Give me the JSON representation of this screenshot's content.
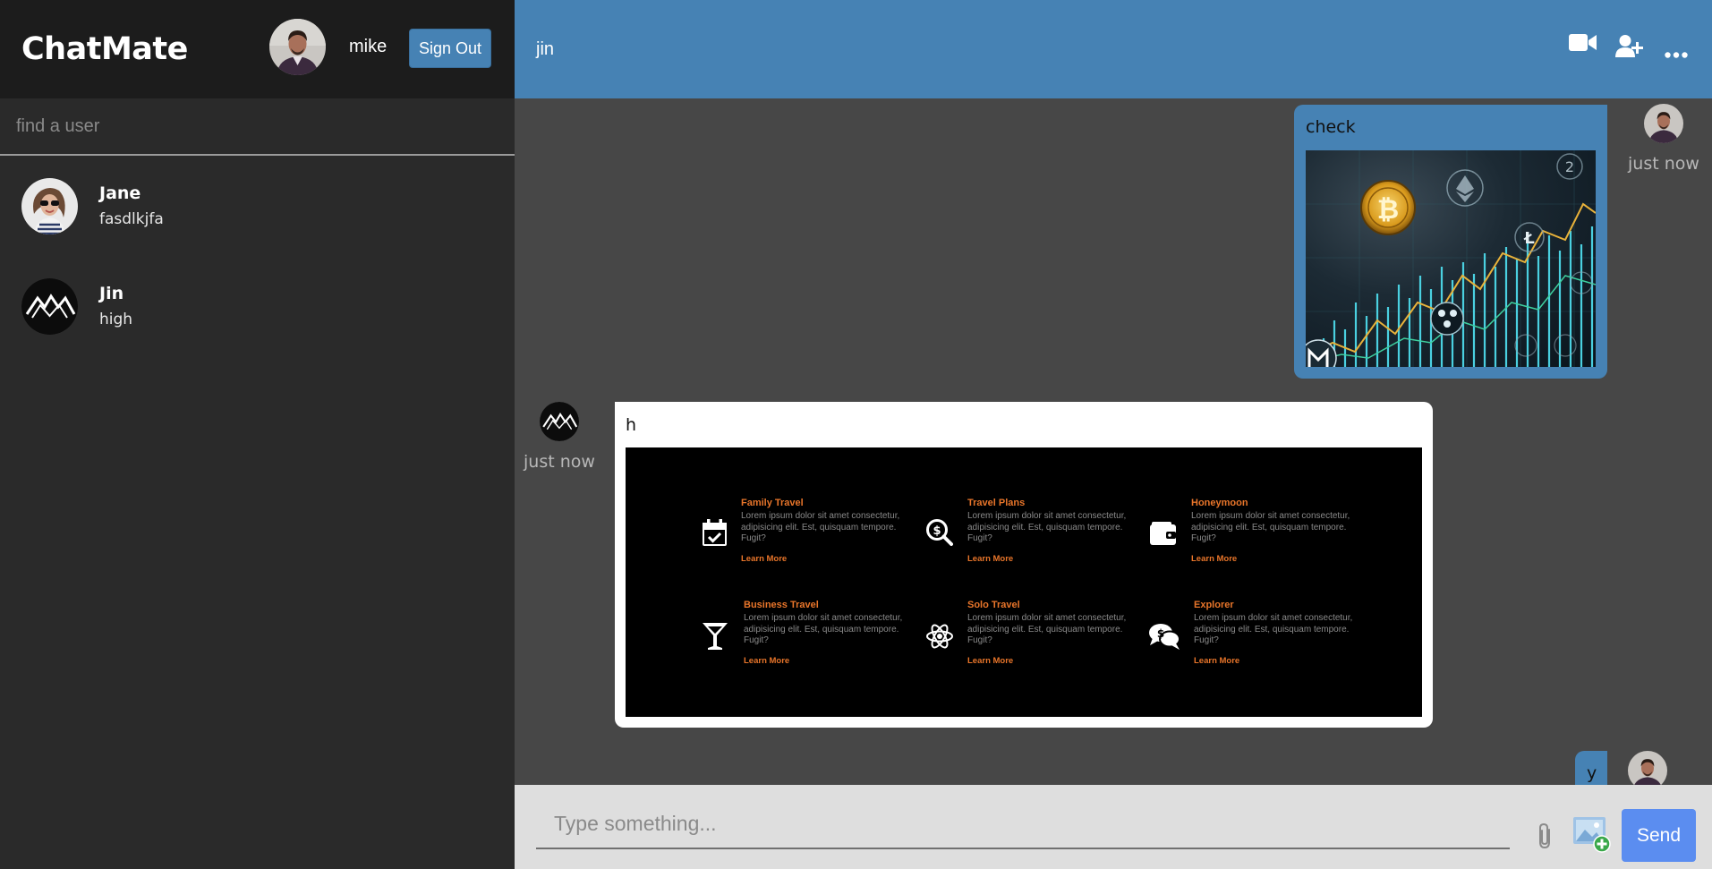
{
  "app": {
    "brand": "ChatMate",
    "current_user": {
      "name": "mike"
    },
    "signout_label": "Sign Out"
  },
  "search": {
    "placeholder": "find a user",
    "value": ""
  },
  "chats": [
    {
      "name": "Jane",
      "last_message": "fasdlkjfa"
    },
    {
      "name": "Jin",
      "last_message": "high"
    }
  ],
  "active_chat": {
    "title": "jin",
    "header_icons": [
      "video-camera-icon",
      "add-user-icon",
      "more-options-icon"
    ]
  },
  "messages": [
    {
      "owner": true,
      "text": "check",
      "time": "just now",
      "image": "crypto-chart-image"
    },
    {
      "owner": false,
      "text": "h",
      "time": "just now",
      "image": "travel-services-image",
      "cards": [
        {
          "title": "Family Travel",
          "body": "Lorem ipsum dolor sit amet consectetur, adipisicing elit. Est, quisquam tempore. Fugit?",
          "link": "Learn More",
          "icon": "calendar-check-icon"
        },
        {
          "title": "Travel Plans",
          "body": "Lorem ipsum dolor sit amet consectetur, adipisicing elit. Est, quisquam tempore. Fugit?",
          "link": "Learn More",
          "icon": "search-dollar-icon"
        },
        {
          "title": "Honeymoon",
          "body": "Lorem ipsum dolor sit amet consectetur, adipisicing elit. Est, quisquam tempore. Fugit?",
          "link": "Learn More",
          "icon": "wallet-icon"
        },
        {
          "title": "Business Travel",
          "body": "Lorem ipsum dolor sit amet consectetur, adipisicing elit. Est, quisquam tempore. Fugit?",
          "link": "Learn More",
          "icon": "cocktail-icon"
        },
        {
          "title": "Solo Travel",
          "body": "Lorem ipsum dolor sit amet consectetur, adipisicing elit. Est, quisquam tempore. Fugit?",
          "link": "Learn More",
          "icon": "atom-icon"
        },
        {
          "title": "Explorer",
          "body": "Lorem ipsum dolor sit amet consectetur, adipisicing elit. Est, quisquam tempore. Fugit?",
          "link": "Learn More",
          "icon": "comments-dollar-icon"
        }
      ]
    },
    {
      "owner": true,
      "text": "y",
      "time": "",
      "image": ""
    }
  ],
  "composer": {
    "placeholder": "Type something...",
    "value": "",
    "attach_icon": "paperclip-icon",
    "image_icon": "add-image-icon",
    "send_label": "Send"
  },
  "colors": {
    "accent": "#4682b4",
    "sidebar": "#2a2a2a",
    "sidebar_header": "#1c1c1c",
    "chat_bg": "#474747",
    "input_bg": "#dedede",
    "send_button": "#5b8df0",
    "card_title": "#e8752a"
  }
}
